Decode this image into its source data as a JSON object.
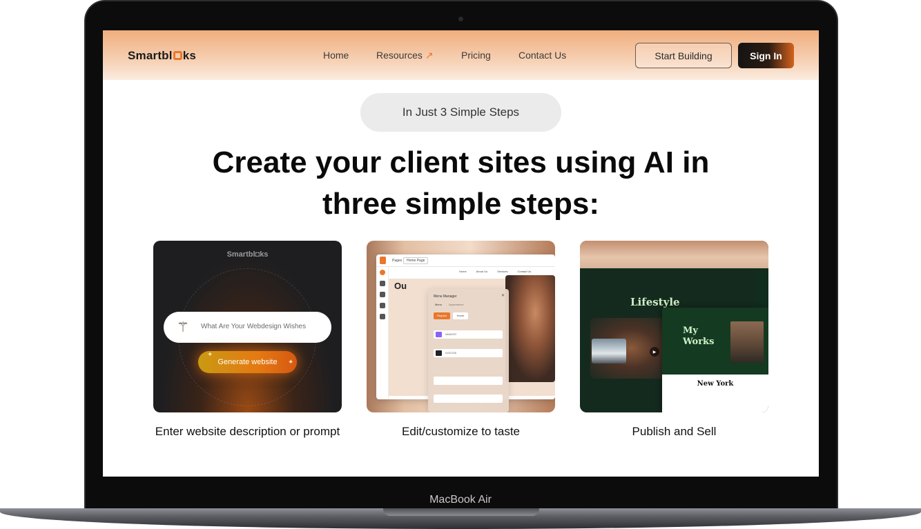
{
  "navbar": {
    "logo_prefix": "Smartbl",
    "logo_suffix": "ks",
    "links": [
      "Home",
      "Resources",
      "Pricing",
      "Contact Us"
    ],
    "resources_arrow": "↗",
    "start_building": "Start Building",
    "sign_in": "Sign In"
  },
  "hero": {
    "pill": "In Just 3 Simple Steps",
    "headline_line1": "Create your client sites using AI in",
    "headline_line2": "three simple steps:"
  },
  "steps": [
    {
      "caption": "Enter website description or prompt",
      "preview": {
        "logo_prefix": "Smartbl",
        "logo_suffix": "ks",
        "input_placeholder": "What Are Your Webdesign Wishes",
        "button_label": "Generate website"
      }
    },
    {
      "caption": "Edit/customize to taste",
      "preview": {
        "toolbar_label": "Pages",
        "toolbar_select": "Home Page",
        "nav": [
          "Home",
          "About Us",
          "Services",
          "Contact Us"
        ],
        "heading": "Ou",
        "modal_title": "Menu Manager",
        "modal_tabs": [
          "Menu",
          "Appearance"
        ],
        "modal_buttons": [
          "Regular",
          "Hover"
        ],
        "color_1": "#8A63F2",
        "color_2": "#1E2326"
      }
    },
    {
      "caption": "Publish and Sell",
      "preview": {
        "lifestyle_title": "Lifestyle",
        "works_title": "My Works",
        "city_title": "New York"
      }
    }
  ],
  "device": {
    "model": "MacBook Air"
  },
  "colors": {
    "brand_orange": "#E9772C",
    "nav_gradient_top": "#F0AE7E",
    "text_dark": "#0A0A0A"
  }
}
